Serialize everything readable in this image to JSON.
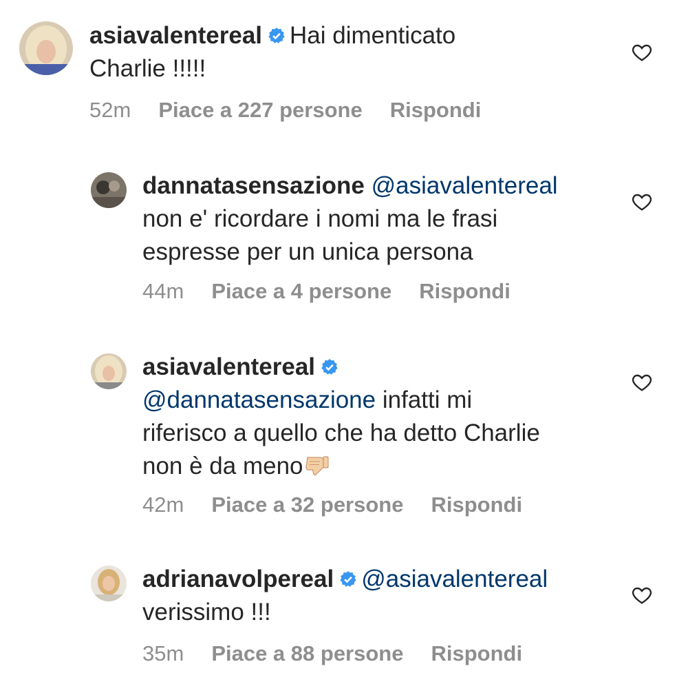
{
  "comments": [
    {
      "username": "asiavalentereal",
      "verified": true,
      "text_line1": "Hai dimenticato",
      "text_line2": "Charlie !!!!!",
      "time": "52m",
      "likes": "Piace a 227 persone",
      "reply": "Rispondi"
    },
    {
      "username": "dannatasensazione",
      "verified": false,
      "mention": "@asiavalentereal",
      "text_line2": "non e' ricordare i nomi ma le frasi",
      "text_line3": "espresse per un unica persona",
      "time": "44m",
      "likes": "Piace a 4 persone",
      "reply": "Rispondi"
    },
    {
      "username": "asiavalentereal",
      "verified": true,
      "mention": "@dannatasensazione",
      "text_line2_rest": " infatti mi",
      "text_line3": "riferisco a quello che ha detto Charlie",
      "text_line4": "non è da meno",
      "emoji": "thumbs-down",
      "time": "42m",
      "likes": "Piace a 32 persone",
      "reply": "Rispondi"
    },
    {
      "username": "adrianavolpereal",
      "verified": true,
      "mention": "@asiavalentereal",
      "text_line2": "verissimo !!!",
      "time": "35m",
      "likes": "Piace a 88 persone",
      "reply": "Rispondi"
    }
  ],
  "icons": {
    "like": "heart-outline-icon",
    "verified": "verified-badge-icon"
  },
  "colors": {
    "mention": "#00376b",
    "meta": "#8e8e8e",
    "verified": "#3897f0"
  }
}
